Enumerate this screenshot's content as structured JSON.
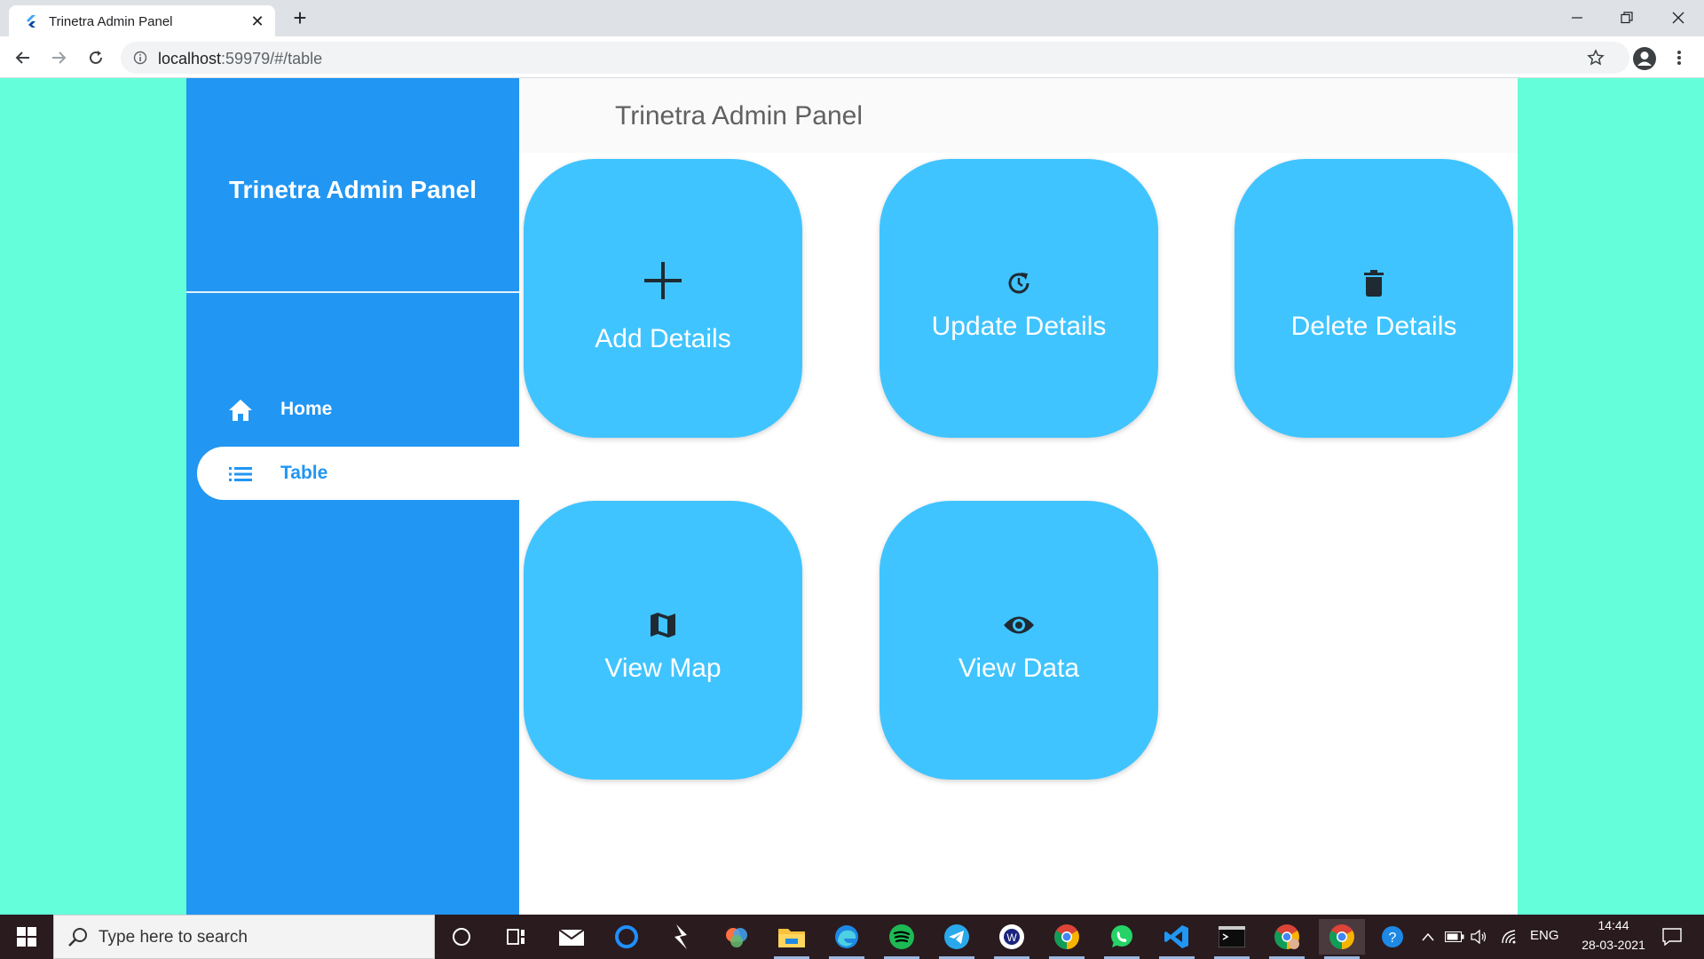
{
  "browser": {
    "tab_title": "Trinetra Admin Panel",
    "tab_close": "✕",
    "new_tab": "+",
    "url_host": "localhost",
    "url_path": ":59979/#/table"
  },
  "sidebar": {
    "title": "Trinetra Admin Panel",
    "items": [
      {
        "label": "Home",
        "icon": "home-icon",
        "active": false
      },
      {
        "label": "Table",
        "icon": "list-icon",
        "active": true
      }
    ]
  },
  "appbar": {
    "title": "Trinetra Admin Panel"
  },
  "cards": [
    {
      "label": "Add Details",
      "icon": "plus-icon"
    },
    {
      "label": "Update Details",
      "icon": "update-icon"
    },
    {
      "label": "Delete Details",
      "icon": "trash-icon"
    },
    {
      "label": "View Map",
      "icon": "map-icon"
    },
    {
      "label": "View Data",
      "icon": "eye-icon"
    }
  ],
  "taskbar": {
    "search_placeholder": "Type here to search",
    "language": "ENG",
    "time": "14:44",
    "date": "28-03-2021"
  },
  "colors": {
    "page_background": "#64ffda",
    "sidebar": "#2196f3",
    "card": "#40c4ff",
    "taskbar": "#2a1b1f"
  }
}
